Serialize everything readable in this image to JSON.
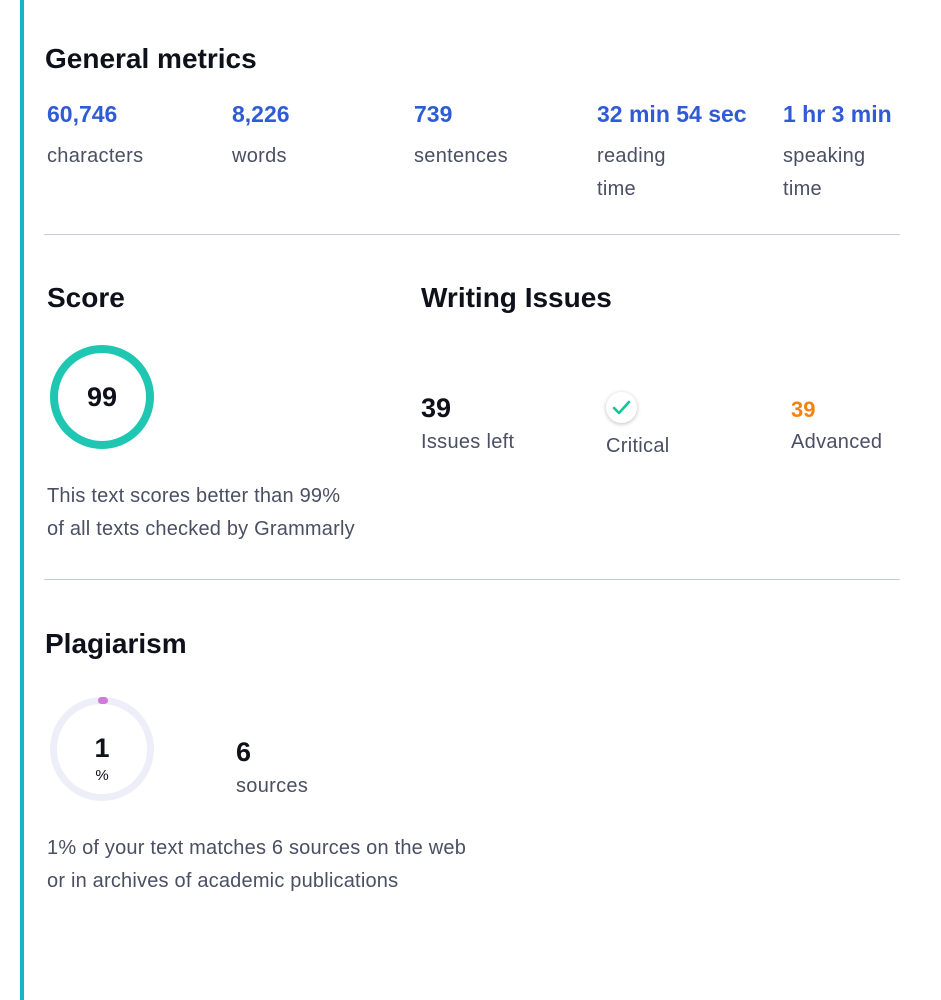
{
  "general_metrics": {
    "title": "General metrics",
    "items": [
      {
        "value": "60,746",
        "label": "characters"
      },
      {
        "value": "8,226",
        "label": "words"
      },
      {
        "value": "739",
        "label": "sentences"
      },
      {
        "value": "32 min 54 sec",
        "label_line1": "reading",
        "label_line2": "time"
      },
      {
        "value": "1 hr 3 min",
        "label_line1": "speaking",
        "label_line2": "time"
      }
    ]
  },
  "score": {
    "title": "Score",
    "value": "99",
    "description_line1": "This text scores better than 99%",
    "description_line2": "of all texts checked by Grammarly",
    "ring_color": "#1fc7b3"
  },
  "writing_issues": {
    "title": "Writing Issues",
    "issues_left": {
      "value": "39",
      "label": "Issues left"
    },
    "critical": {
      "label": "Critical",
      "icon": "check-icon"
    },
    "advanced": {
      "value": "39",
      "label": "Advanced",
      "color": "#f5820d"
    }
  },
  "plagiarism": {
    "title": "Plagiarism",
    "percent_value": "1",
    "percent_sign": "%",
    "percent_fraction": 0.01,
    "sources": {
      "value": "6",
      "label": "sources"
    },
    "description_line1": "1% of your text matches 6 sources on the web",
    "description_line2": "or in archives of academic publications"
  },
  "colors": {
    "accent_blue": "#2f5bd6",
    "accent_teal": "#1fc7b3",
    "advanced_orange": "#f5820d",
    "critical_green": "#15c39a",
    "plagiarism_pink": "#d17bd8"
  }
}
